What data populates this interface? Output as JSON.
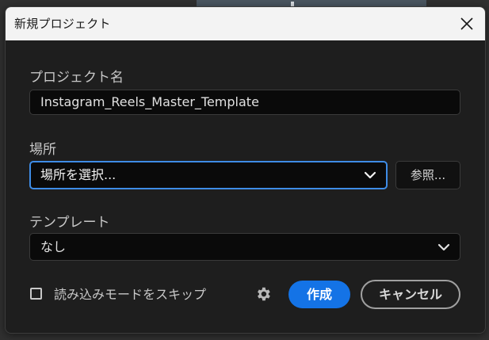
{
  "dialog": {
    "title": "新規プロジェクト",
    "close_icon": "close-icon"
  },
  "project_name": {
    "label": "プロジェクト名",
    "value": "Instagram_Reels_Master_Template"
  },
  "location": {
    "label": "場所",
    "value": "場所を選択...",
    "browse_label": "参照..."
  },
  "template": {
    "label": "テンプレート",
    "value": "なし"
  },
  "footer": {
    "skip_import_label": "読み込みモードをスキップ",
    "skip_import_checked": false,
    "settings_icon": "gear-icon",
    "create_label": "作成",
    "cancel_label": "キャンセル"
  },
  "colors": {
    "accent": "#1473e6",
    "focus_border": "#3e8ce6",
    "dialog_bg": "#1e1e1e",
    "titlebar_bg": "#f3f3f3"
  }
}
